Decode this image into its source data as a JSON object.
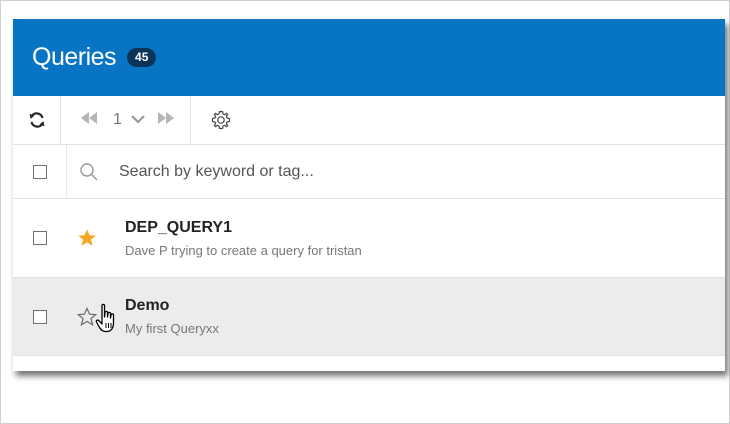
{
  "header": {
    "title": "Queries",
    "count": "45"
  },
  "toolbar": {
    "page_number": "1"
  },
  "search": {
    "placeholder": "Search by keyword or tag..."
  },
  "queries": [
    {
      "name": "DEP_QUERY1",
      "description": "Dave P trying to create a query for tristan",
      "starred": true
    },
    {
      "name": "Demo",
      "description": "My first Queryxx",
      "starred": false
    }
  ],
  "colors": {
    "header_bg": "#0874c4",
    "badge_bg": "#0b3558",
    "star_filled": "#f5a623",
    "hover_row": "#ececec"
  },
  "icons": [
    "refresh-icon",
    "first-page-icon",
    "chevron-down-icon",
    "last-page-icon",
    "gear-icon",
    "search-icon",
    "star-filled-icon",
    "star-outline-icon",
    "hand-cursor-icon"
  ]
}
